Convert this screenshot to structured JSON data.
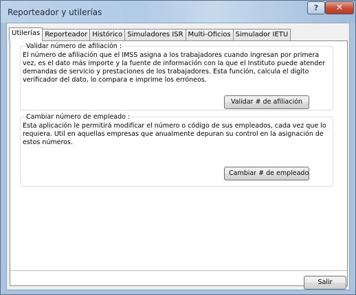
{
  "window": {
    "title": "Reporteador y utilerías",
    "help_glyph": "?",
    "close_glyph": "✕"
  },
  "tabs": [
    {
      "label": "Utilerías",
      "active": true
    },
    {
      "label": "Reporteador",
      "active": false
    },
    {
      "label": "Histórico",
      "active": false
    },
    {
      "label": "Simuladores ISR",
      "active": false
    },
    {
      "label": "Multi-Oficios",
      "active": false
    },
    {
      "label": "Simulador IETU",
      "active": false
    }
  ],
  "groups": {
    "afiliacion": {
      "legend": "Validar número de afiliación :",
      "description": "El número de afiliación que el IMSS asigna a los trabajadores cuando ingresan por primera vez, es el dato más importe y la fuente de información con la que el Instituto puede atender demandas de servicio y prestaciones de los trabajadores. Esta función, calcula el digito verificador del dato, lo compara e imprime los erróneos.",
      "button": "Validar # de afiliación"
    },
    "empleado": {
      "legend": "Cambiar número de empleado :",
      "description": "Esta aplicación le permitirá modificar el número o código de sus empleados, cada vez que lo requiera. Util en aquellas empresas que anualmente depuran su control en la asignación de estos números.",
      "button": "Cambiar # de empleado"
    }
  },
  "footer": {
    "exit_button": "Salir"
  }
}
